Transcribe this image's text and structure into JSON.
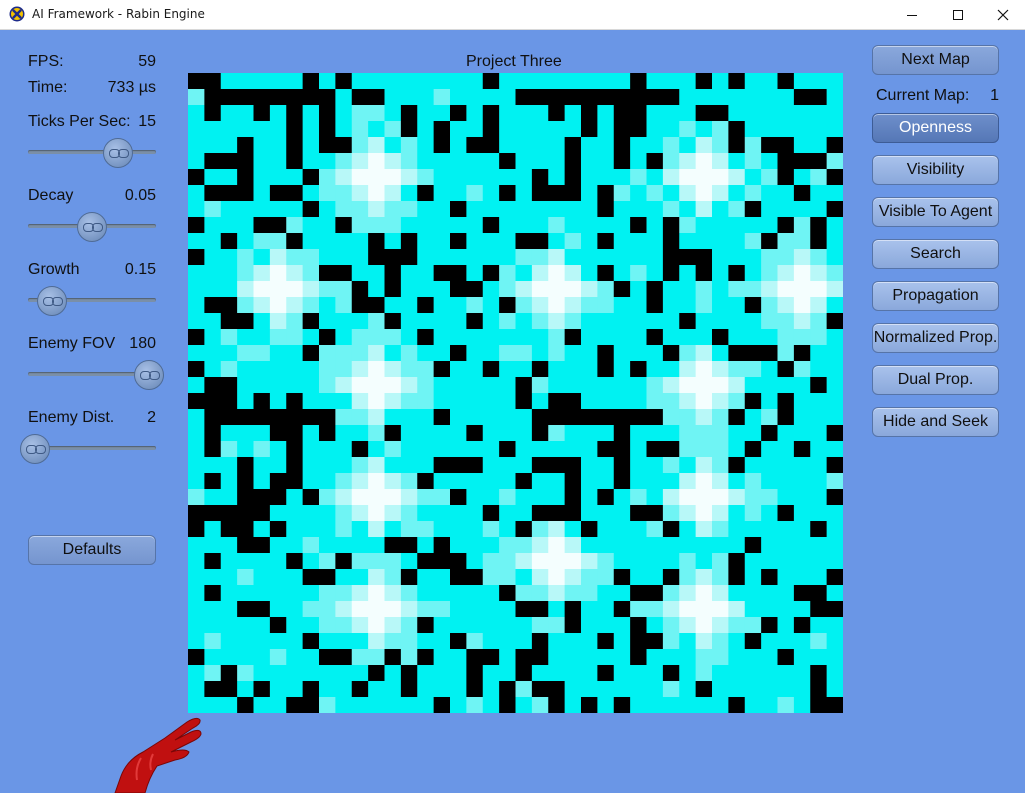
{
  "window": {
    "title": "AI Framework - Rabin Engine",
    "minimize_icon": "minimize-icon",
    "maximize_icon": "maximize-icon",
    "close_icon": "close-icon"
  },
  "header": {
    "title": "Project Three"
  },
  "stats": {
    "fps_label": "FPS:",
    "fps_value": "59",
    "time_label": "Time:",
    "time_value": "733 µs"
  },
  "sliders": [
    {
      "label": "Ticks Per Sec:",
      "value": "15",
      "level": 0.73
    },
    {
      "label": "Decay",
      "value": "0.05",
      "level": 0.5
    },
    {
      "label": "Growth",
      "value": "0.15",
      "level": 0.15
    },
    {
      "label": "Enemy FOV",
      "value": "180",
      "level": 1.0
    },
    {
      "label": "Enemy Dist.",
      "value": "2",
      "level": 0.0
    }
  ],
  "defaults_button": "Defaults",
  "right_panel": {
    "next_map": "Next Map",
    "current_map_label": "Current Map:",
    "current_map_value": "1",
    "modes": [
      "Openness",
      "Visibility",
      "Visible To Agent",
      "Search",
      "Propagation",
      "Normalized Prop.",
      "Dual Prop.",
      "Hide and Seek"
    ],
    "active_mode": "Openness"
  },
  "grid": {
    "size": 40,
    "colors": {
      "wall": "#000000",
      "base": "#00f2f2",
      "light": "#6ff4f4",
      "pale": "#b8f8f8",
      "white": "#f4fefe"
    }
  },
  "colors": {
    "background": "#6a96e6",
    "agent": "#c01010"
  }
}
